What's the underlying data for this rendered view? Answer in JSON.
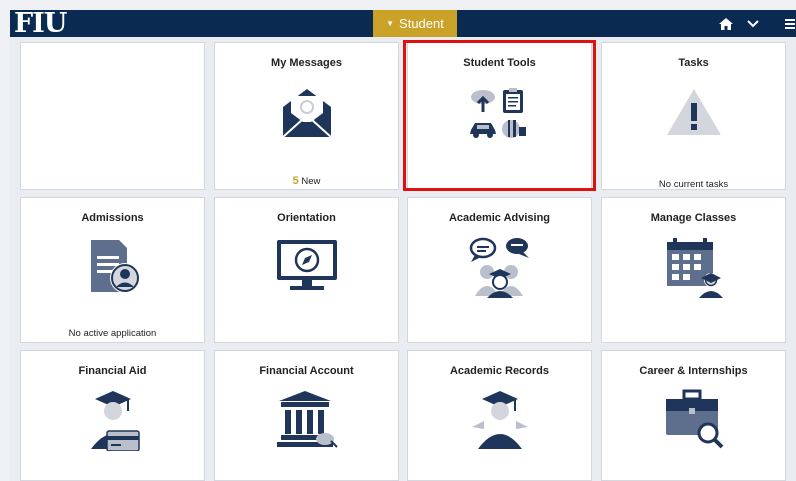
{
  "header": {
    "logo": "FIU",
    "tab_label": "Student"
  },
  "tiles": {
    "my_messages": {
      "title": "My Messages",
      "count": "5",
      "count_label": "New"
    },
    "student_tools": {
      "title": "Student Tools"
    },
    "tasks": {
      "title": "Tasks",
      "footer": "No current tasks"
    },
    "admissions": {
      "title": "Admissions",
      "footer": "No active application"
    },
    "orientation": {
      "title": "Orientation"
    },
    "academic_advising": {
      "title": "Academic Advising"
    },
    "manage_classes": {
      "title": "Manage Classes"
    },
    "financial_aid": {
      "title": "Financial Aid"
    },
    "financial_account": {
      "title": "Financial Account"
    },
    "academic_records": {
      "title": "Academic Records"
    },
    "career_internships": {
      "title": "Career & Internships"
    }
  },
  "colors": {
    "header_bg": "#0b2a52",
    "tab_gold": "#c9a227",
    "icon_navy": "#1f3559",
    "highlight_red": "#e01010"
  }
}
